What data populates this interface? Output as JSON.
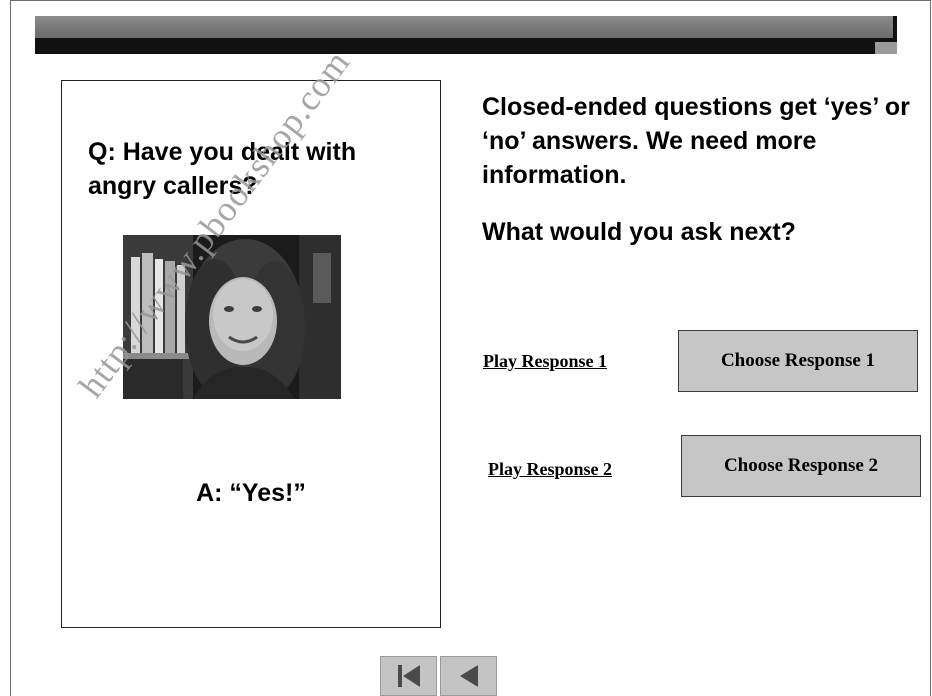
{
  "card": {
    "question": "Q: Have you dealt with angry callers?",
    "answer": "A: “Yes!”"
  },
  "explanation": "Closed-ended questions get ‘yes’ or ‘no’ answers. We need more information.",
  "prompt": "What would you ask next?",
  "responses": [
    {
      "play_label": "Play Response 1",
      "choose_label": "Choose Response 1"
    },
    {
      "play_label": "Play Response 2",
      "choose_label": "Choose Response 2"
    }
  ],
  "navigation": {
    "first_icon": "skip-to-start-icon",
    "prev_icon": "previous-icon"
  },
  "watermark": "http://www.pbookshop.com"
}
